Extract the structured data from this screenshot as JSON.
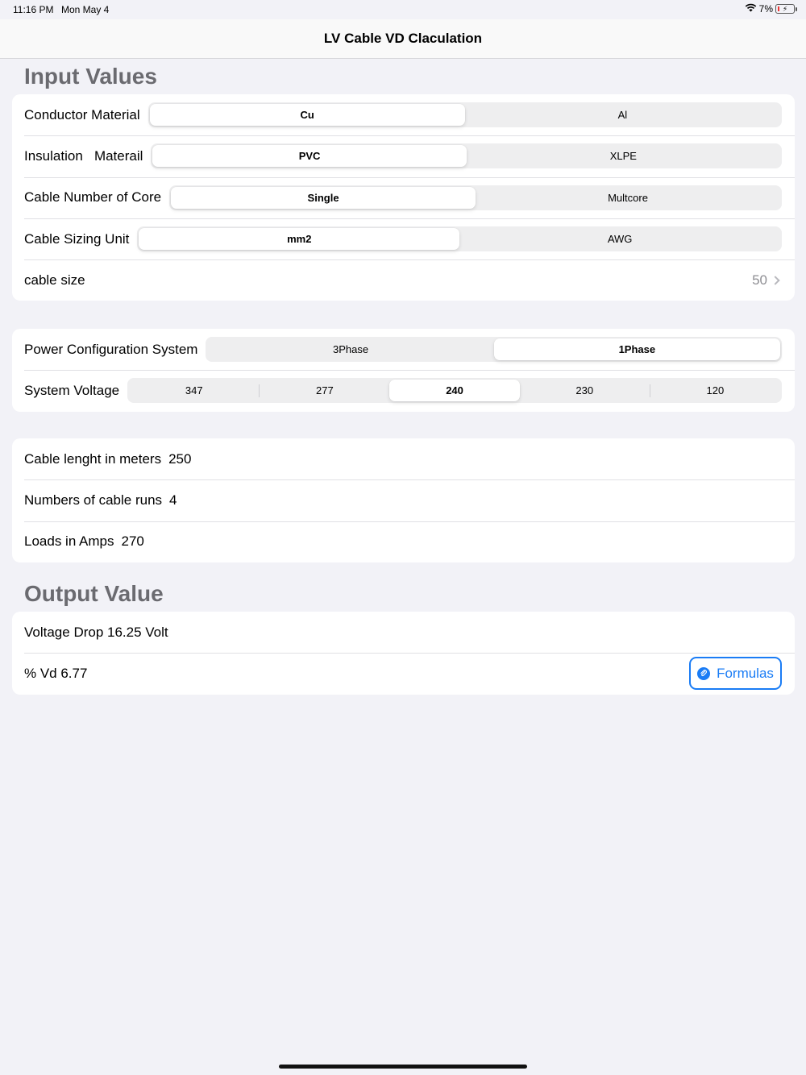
{
  "status": {
    "time": "11:16 PM",
    "date": "Mon May 4",
    "battery": "7%"
  },
  "nav": {
    "title": "LV Cable VD Claculation"
  },
  "input_section": {
    "header": "Input Values",
    "conductor": {
      "label": "Conductor Material",
      "options": [
        "Cu",
        "Al"
      ],
      "selected": 0
    },
    "insulation": {
      "label": "Insulation   Materail",
      "options": [
        "PVC",
        "XLPE"
      ],
      "selected": 0
    },
    "cores": {
      "label": "Cable Number of Core",
      "options": [
        "Single",
        "Multcore"
      ],
      "selected": 0
    },
    "sizing_unit": {
      "label": "Cable Sizing Unit",
      "options": [
        "mm2",
        "AWG"
      ],
      "selected": 0
    },
    "cable_size": {
      "label": "cable size",
      "value": "50"
    }
  },
  "power_section": {
    "config": {
      "label": "Power Configuration System",
      "options": [
        "3Phase",
        "1Phase"
      ],
      "selected": 1
    },
    "voltage": {
      "label": "System Voltage",
      "options": [
        "347",
        "277",
        "240",
        "230",
        "120"
      ],
      "selected": 2
    }
  },
  "cable_section": {
    "length": {
      "label": "Cable lenght in meters",
      "value": "250"
    },
    "runs": {
      "label": "Numbers of cable runs",
      "value": "4"
    },
    "load": {
      "label": "Loads in Amps",
      "value": "270"
    }
  },
  "output_section": {
    "header": "Output Value",
    "voltage_drop": "Voltage Drop 16.25 Volt",
    "percent_vd": "% Vd 6.77",
    "formulas_label": "Formulas"
  },
  "colors": {
    "accent": "#1a7cf5",
    "background": "#f2f2f7",
    "header_text": "#6b6b70"
  }
}
